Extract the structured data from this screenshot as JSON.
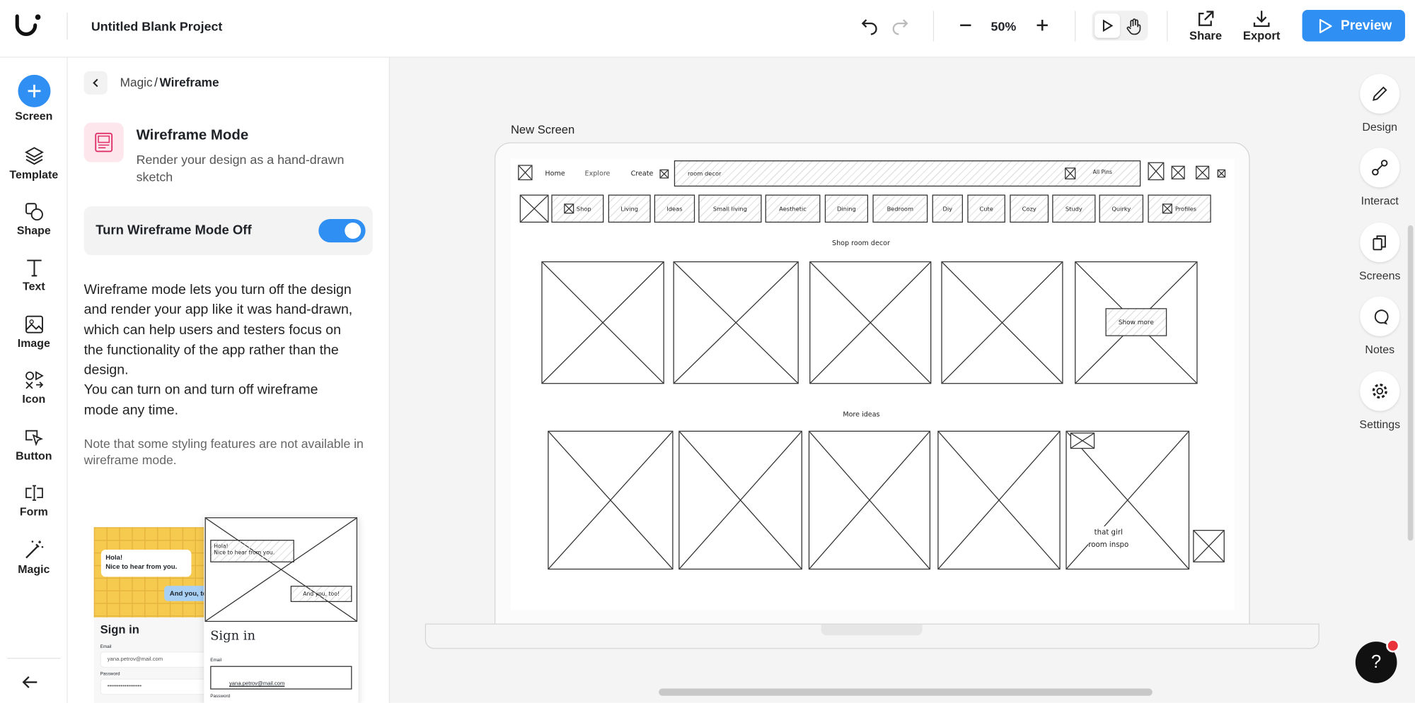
{
  "header": {
    "project_title": "Untitled Blank Project",
    "zoom": "50%",
    "share_label": "Share",
    "export_label": "Export",
    "preview_label": "Preview"
  },
  "rail": {
    "items": [
      {
        "label": "Screen",
        "icon": "plus-icon"
      },
      {
        "label": "Template",
        "icon": "layers-icon"
      },
      {
        "label": "Shape",
        "icon": "shapes-icon"
      },
      {
        "label": "Text",
        "icon": "text-icon"
      },
      {
        "label": "Image",
        "icon": "image-icon"
      },
      {
        "label": "Icon",
        "icon": "icons-icon"
      },
      {
        "label": "Button",
        "icon": "cursor-click-icon"
      },
      {
        "label": "Form",
        "icon": "text-field-icon"
      },
      {
        "label": "Magic",
        "icon": "magic-wand-icon"
      }
    ]
  },
  "panel": {
    "breadcrumb_parent": "Magic",
    "breadcrumb_sep": "/",
    "breadcrumb_current": "Wireframe",
    "title": "Wireframe Mode",
    "subtitle": "Render your design as a hand-drawn sketch",
    "toggle_label": "Turn Wireframe Mode Off",
    "toggle_on": true,
    "description": "Wireframe mode lets you turn off the design and render your app like it was hand-drawn, which can help users and testers focus on the functionality of the app rather than the design.",
    "description2": "You can turn on and turn off wireframe mode any time.",
    "note": "Note that some styling features are not available in wireframe mode.",
    "preview": {
      "bubble1_line1": "Hola!",
      "bubble1_line2": "Nice to hear from you.",
      "bubble2": "And you, too!",
      "signin": "Sign in",
      "email_label": "Email",
      "email_value": "yana.petrov@mail.com",
      "password_label": "Password",
      "password_value": "••••••••••••••••••"
    }
  },
  "canvas": {
    "screen_name": "New Screen",
    "nav": {
      "home": "Home",
      "explore": "Explore",
      "create": "Create",
      "search": "room decor",
      "all_pins": "All Pins"
    },
    "chips": [
      "Shop",
      "Living",
      "Ideas",
      "Small living",
      "Aesthetic",
      "Dining",
      "Bedroom",
      "Diy",
      "Cute",
      "Cozy",
      "Study",
      "Quirky",
      "Profiles"
    ],
    "section1": "Shop room decor",
    "show_more": "Show more",
    "section2": "More ideas",
    "tile_caption_1": "that girl",
    "tile_caption_2": "room inspo"
  },
  "rrail": {
    "items": [
      {
        "label": "Design",
        "icon": "pencil-icon"
      },
      {
        "label": "Interact",
        "icon": "interact-icon"
      },
      {
        "label": "Screens",
        "icon": "screens-icon"
      },
      {
        "label": "Notes",
        "icon": "comment-icon"
      },
      {
        "label": "Settings",
        "icon": "gear-icon"
      }
    ]
  },
  "help": {
    "label": "?"
  },
  "colors": {
    "accent": "#2f8ff3",
    "toggle": "#2f8ff3",
    "help_bg": "#111111",
    "badge": "#e8333a"
  }
}
